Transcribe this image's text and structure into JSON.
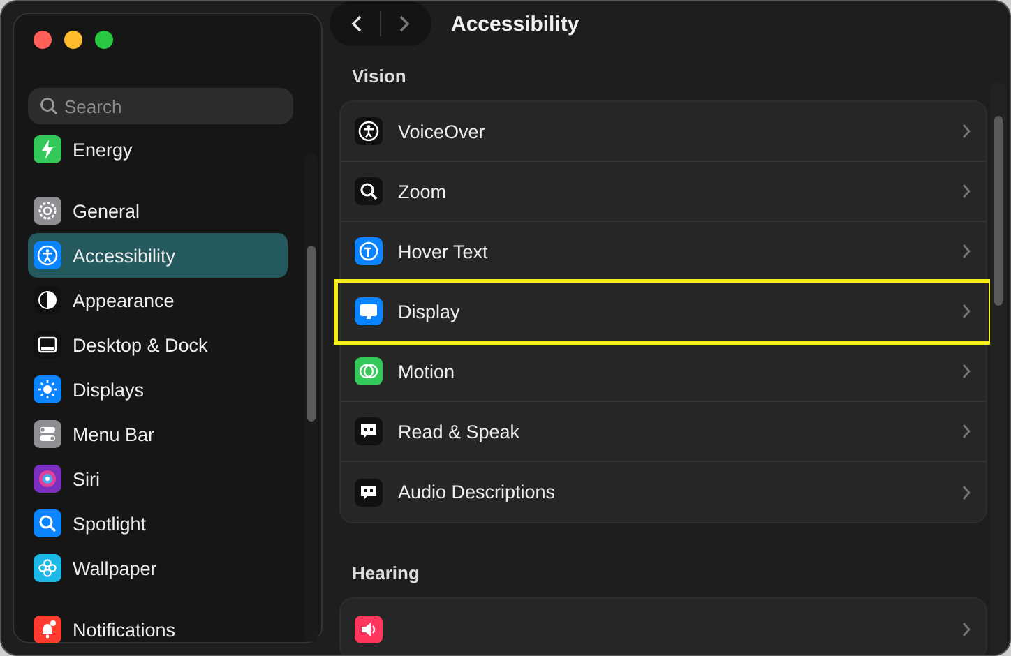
{
  "window": {
    "title": "Accessibility"
  },
  "sidebar": {
    "search": {
      "placeholder": "Search"
    },
    "groups": [
      {
        "items": [
          {
            "label": "Energy",
            "selected": false
          }
        ]
      },
      {
        "items": [
          {
            "label": "General",
            "selected": false
          },
          {
            "label": "Accessibility",
            "selected": true
          },
          {
            "label": "Appearance",
            "selected": false
          },
          {
            "label": "Desktop & Dock",
            "selected": false
          },
          {
            "label": "Displays",
            "selected": false
          },
          {
            "label": "Menu Bar",
            "selected": false
          },
          {
            "label": "Siri",
            "selected": false
          },
          {
            "label": "Spotlight",
            "selected": false
          },
          {
            "label": "Wallpaper",
            "selected": false
          }
        ]
      },
      {
        "items": [
          {
            "label": "Notifications",
            "selected": false
          }
        ]
      }
    ]
  },
  "sections": [
    {
      "title": "Vision",
      "rows": [
        {
          "label": "VoiceOver",
          "highlighted": false
        },
        {
          "label": "Zoom",
          "highlighted": false
        },
        {
          "label": "Hover Text",
          "highlighted": false
        },
        {
          "label": "Display",
          "highlighted": true
        },
        {
          "label": "Motion",
          "highlighted": false
        },
        {
          "label": "Read & Speak",
          "highlighted": false
        },
        {
          "label": "Audio Descriptions",
          "highlighted": false
        }
      ]
    },
    {
      "title": "Hearing",
      "rows": [
        {
          "highlighted": false
        }
      ]
    }
  ]
}
